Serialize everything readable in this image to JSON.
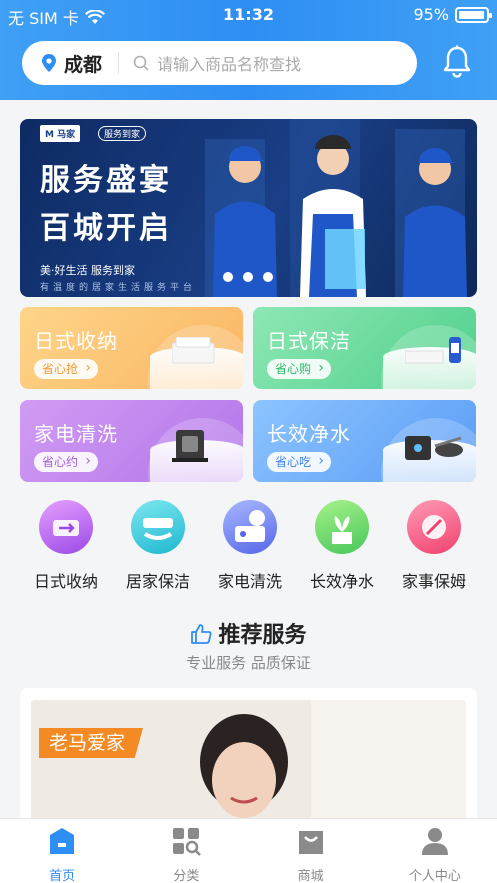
{
  "status_bar": {
    "carrier": "无 SIM 卡",
    "time": "11:32",
    "battery_percent": "95%",
    "battery_level": 0.95
  },
  "header": {
    "city": "成都",
    "search_placeholder": "请输入商品名称查找"
  },
  "banner": {
    "logo_text": "M 马家",
    "tag_text": "服务到家",
    "headline_1": "服务盛宴",
    "headline_2": "百城开启",
    "sub_line": "美·好生活 服务到家",
    "sub_line_2": "有温度的居家生活服务平台",
    "dots": 3
  },
  "cards": [
    {
      "title": "日式收纳",
      "cta": "省心抢",
      "color_from": "#ffd58a",
      "color_to": "#f9b562",
      "btn_color": "#f39a3a"
    },
    {
      "title": "日式保洁",
      "cta": "省心购",
      "color_from": "#8ee7b4",
      "color_to": "#4fd08a",
      "btn_color": "#2fb86e"
    },
    {
      "title": "家电清洗",
      "cta": "省心约",
      "color_from": "#d19cf3",
      "color_to": "#b275ea",
      "btn_color": "#a060e0"
    },
    {
      "title": "长效净水",
      "cta": "省心吃",
      "color_from": "#8cc4ff",
      "color_to": "#5a9cf6",
      "btn_color": "#3f86f0"
    }
  ],
  "services": [
    {
      "label": "日式收纳",
      "icon": "storage-icon",
      "color_from": "#e6a0ff",
      "color_to": "#9b49e6"
    },
    {
      "label": "居家保洁",
      "icon": "cleaning-icon",
      "color_from": "#7de7ef",
      "color_to": "#1fb8d0"
    },
    {
      "label": "家电清洗",
      "icon": "appliance-icon",
      "color_from": "#a9b8ff",
      "color_to": "#5566e8"
    },
    {
      "label": "长效净水",
      "icon": "water-icon",
      "color_from": "#a6f28a",
      "color_to": "#47c75a"
    },
    {
      "label": "家事保姆",
      "icon": "nanny-icon",
      "color_from": "#ff9ab6",
      "color_to": "#f0426e"
    }
  ],
  "recommend": {
    "title": "推荐服务",
    "subtitle": "专业服务 品质保证",
    "card_tag": "老马爱家"
  },
  "tabbar": [
    {
      "label": "首页",
      "icon": "home-icon",
      "active": true
    },
    {
      "label": "分类",
      "icon": "category-icon",
      "active": false
    },
    {
      "label": "商城",
      "icon": "shop-bag-icon",
      "active": false
    },
    {
      "label": "个人中心",
      "icon": "user-icon",
      "active": false
    }
  ],
  "colors": {
    "accent": "#2f8ef3",
    "active_tab": "#2f8ef3",
    "inactive_tab": "#888888"
  }
}
